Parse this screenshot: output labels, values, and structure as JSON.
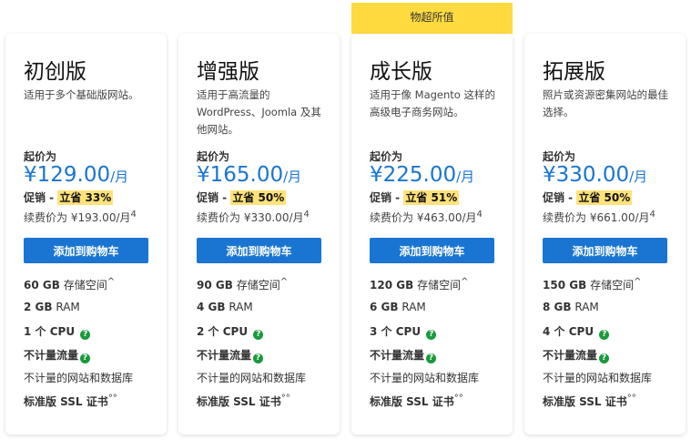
{
  "badge": "物超所值",
  "common": {
    "from": "起价为",
    "per": "/月",
    "promo_prefix": "促销 - ",
    "renew_prefix": "续费价为 ",
    "renew_sup": "4",
    "button": "添加到购物车",
    "storage_label": "存储空间",
    "storage_sup": "^",
    "ram_label": "RAM",
    "cpu_label": "个 CPU",
    "bandwidth": "不计量流量",
    "sites": "不计量的网站和数据库",
    "ssl": "标准版 SSL 证书",
    "ssl_sup": "°°",
    "help": "?"
  },
  "plans": [
    {
      "name": "初创版",
      "desc": "适用于多个基础版网站。",
      "price": "¥129.00",
      "save": "立省 33%",
      "renew": "¥193.00/月",
      "storage": "60 GB",
      "ram": "2 GB",
      "cpu": "1"
    },
    {
      "name": "增强版",
      "desc": "适用于高流量的 WordPress、Joomla 及其他网站。",
      "price": "¥165.00",
      "save": "立省 50%",
      "renew": "¥330.00/月",
      "storage": "90 GB",
      "ram": "4 GB",
      "cpu": "2"
    },
    {
      "name": "成长版",
      "desc": "适用于像 Magento 这样的高级电子商务网站。",
      "price": "¥225.00",
      "save": "立省 51%",
      "renew": "¥463.00/月",
      "storage": "120 GB",
      "ram": "6 GB",
      "cpu": "3"
    },
    {
      "name": "拓展版",
      "desc": "照片或资源密集网站的最佳选择。",
      "price": "¥330.00",
      "save": "立省 50%",
      "renew": "¥661.00/月",
      "storage": "150 GB",
      "ram": "8 GB",
      "cpu": "4"
    }
  ]
}
